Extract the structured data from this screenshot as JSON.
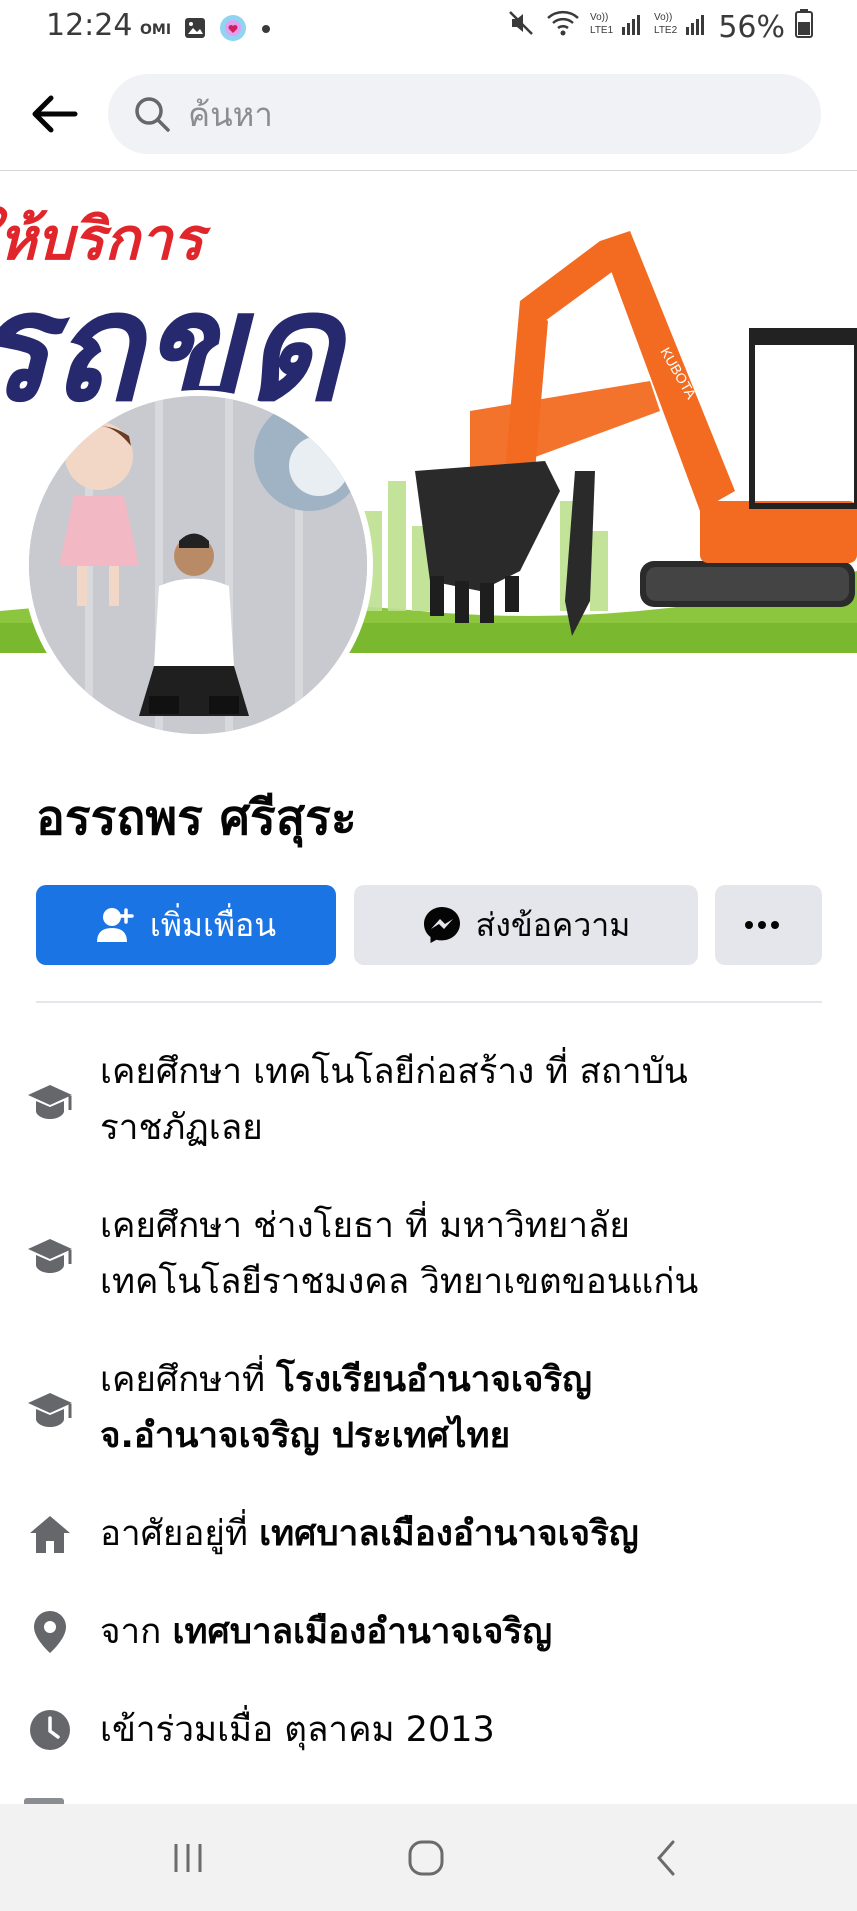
{
  "status_bar": {
    "time": "12:24",
    "notif_text": "OMI",
    "battery": "56%",
    "sim1": "VoLTE1",
    "sim2": "VoLTE2"
  },
  "search": {
    "placeholder": "ค้นหา"
  },
  "cover": {
    "line1": "ให้บริการ",
    "line2": "รถขุด",
    "brand": "KUBOTA"
  },
  "profile": {
    "name": "อรรถพร ศรีสุระ"
  },
  "actions": {
    "add_friend": "เพิ่มเพื่อน",
    "message": "ส่งข้อความ",
    "more": "···"
  },
  "details": [
    {
      "icon": "graduation-cap-icon",
      "prefix": "เคยศึกษา เทคโนโลยีก่อสร้าง ที่ สถาบัน",
      "line2": "ราชภัฏเลย"
    },
    {
      "icon": "graduation-cap-icon",
      "prefix": "เคยศึกษา ช่างโยธา ที่ มหาวิทยาลัย",
      "line2": "เทคโนโลยีราชมงคล วิทยาเขตขอนแก่น"
    },
    {
      "icon": "graduation-cap-icon",
      "prefix": "เคยศึกษาที่ ",
      "bold": "โรงเรียนอำนาจเจริญ",
      "line2_bold": "จ.อำนาจเจริญ ประเทศไทย"
    },
    {
      "icon": "home-icon",
      "prefix": "อาศัยอยู่ที่ ",
      "bold": "เทศบาลเมืองอำนาจเจริญ"
    },
    {
      "icon": "location-pin-icon",
      "prefix": "จาก ",
      "bold": "เทศบาลเมืองอำนาจเจริญ"
    },
    {
      "icon": "clock-icon",
      "prefix": "เข้าร่วมเมื่อ ตุลาคม  2013"
    }
  ],
  "colors": {
    "primary": "#1b74e4",
    "secondary_btn": "#e4e6eb",
    "icon_gray": "#65676b",
    "search_bg": "#f0f2f5"
  }
}
